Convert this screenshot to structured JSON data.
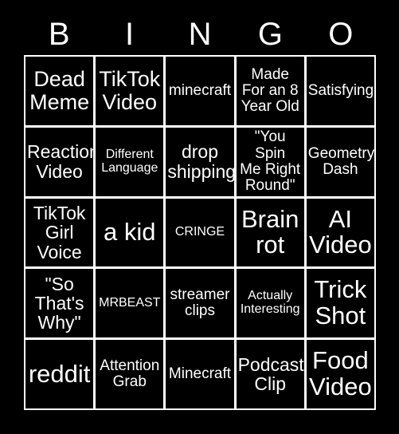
{
  "card": {
    "title_letters": [
      "B",
      "I",
      "N",
      "G",
      "O"
    ],
    "background_color": "#000000",
    "text_color": "#ffffff",
    "grid_line_color": "#ffffff",
    "rows": 5,
    "columns": 5
  },
  "cells": [
    {
      "text": "Dead\nMeme",
      "size": "xl"
    },
    {
      "text": "TikTok\nVideo",
      "size": "xl"
    },
    {
      "text": "minecraft",
      "size": "md"
    },
    {
      "text": "Made\nFor an 8\nYear Old",
      "size": "md"
    },
    {
      "text": "Satisfying",
      "size": "md"
    },
    {
      "text": "Reaction\nVideo",
      "size": "lg"
    },
    {
      "text": "Different\nLanguage",
      "size": "sm"
    },
    {
      "text": "drop\nshipping",
      "size": "lg"
    },
    {
      "text": "\"You Spin\nMe Right\nRound\"",
      "size": "md"
    },
    {
      "text": "Geometry\nDash",
      "size": "md"
    },
    {
      "text": "TikTok\nGirl\nVoice",
      "size": "lg"
    },
    {
      "text": "a kid",
      "size": "xxl"
    },
    {
      "text": "CRINGE",
      "size": "sm"
    },
    {
      "text": "Brain\nrot",
      "size": "xxl"
    },
    {
      "text": "AI\nVideo",
      "size": "xxl"
    },
    {
      "text": "\"So\nThat's\nWhy\"",
      "size": "lg"
    },
    {
      "text": "MRBEAST",
      "size": "sm"
    },
    {
      "text": "streamer\nclips",
      "size": "md"
    },
    {
      "text": "Actually\nInteresting",
      "size": "sm"
    },
    {
      "text": "Trick\nShot",
      "size": "xxl"
    },
    {
      "text": "reddit",
      "size": "xxl"
    },
    {
      "text": "Attention\nGrab",
      "size": "md"
    },
    {
      "text": "Minecraft",
      "size": "md"
    },
    {
      "text": "Podcast\nClip",
      "size": "lg"
    },
    {
      "text": "Food\nVideo",
      "size": "xxl"
    }
  ]
}
